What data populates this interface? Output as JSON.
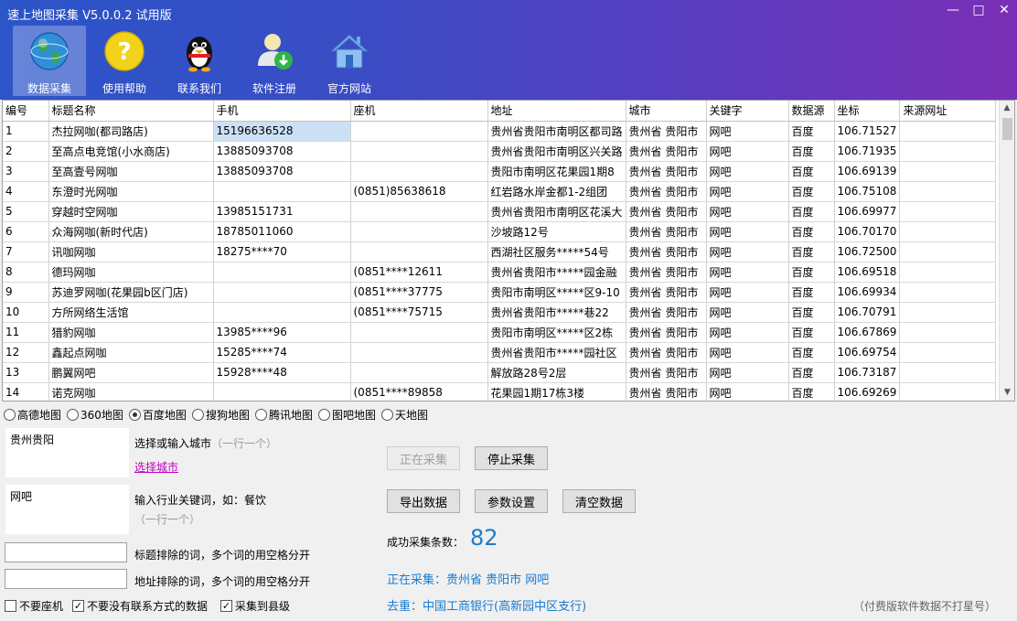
{
  "window": {
    "title": "速上地图采集 V5.0.0.2 试用版",
    "controls": [
      "—",
      "□",
      "✕"
    ]
  },
  "toolbar": [
    {
      "label": "数据采集",
      "icon": "globe-icon"
    },
    {
      "label": "使用帮助",
      "icon": "help-icon"
    },
    {
      "label": "联系我们",
      "icon": "qq-penguin-icon"
    },
    {
      "label": "软件注册",
      "icon": "user-register-icon"
    },
    {
      "label": "官方网站",
      "icon": "home-icon"
    }
  ],
  "table": {
    "columns": [
      "编号",
      "标题名称",
      "手机",
      "座机",
      "地址",
      "城市",
      "关键字",
      "数据源",
      "坐标",
      "来源网址"
    ],
    "rows": [
      [
        "1",
        "杰拉网咖(都司路店)",
        "15196636528",
        "",
        "贵州省贵阳市南明区都司路",
        "贵州省 贵阳市",
        "网吧",
        "百度",
        "106.71527",
        ""
      ],
      [
        "2",
        "至高点电竞馆(小水商店)",
        "13885093708",
        "",
        "贵州省贵阳市南明区兴关路",
        "贵州省 贵阳市",
        "网吧",
        "百度",
        "106.71935",
        ""
      ],
      [
        "3",
        "至高壹号网咖",
        "13885093708",
        "",
        "贵阳市南明区花果园1期8",
        "贵州省 贵阳市",
        "网吧",
        "百度",
        "106.69139",
        ""
      ],
      [
        "4",
        "东澄时光网咖",
        "",
        "(0851)85638618",
        "红岩路水岸金都1-2组团",
        "贵州省 贵阳市",
        "网吧",
        "百度",
        "106.75108",
        ""
      ],
      [
        "5",
        "穿越时空网咖",
        "13985151731",
        "",
        "贵州省贵阳市南明区花溪大",
        "贵州省 贵阳市",
        "网吧",
        "百度",
        "106.69977",
        ""
      ],
      [
        "6",
        "众海网咖(新时代店)",
        "18785011060",
        "",
        "沙坡路12号",
        "贵州省 贵阳市",
        "网吧",
        "百度",
        "106.70170",
        ""
      ],
      [
        "7",
        "讯咖网咖",
        "18275****70",
        "",
        "西湖社区服务*****54号",
        "贵州省 贵阳市",
        "网吧",
        "百度",
        "106.72500",
        ""
      ],
      [
        "8",
        "德玛网咖",
        "",
        "(0851****12611",
        "贵州省贵阳市*****园金融",
        "贵州省 贵阳市",
        "网吧",
        "百度",
        "106.69518",
        ""
      ],
      [
        "9",
        "苏迪罗网咖(花果园b区门店)",
        "",
        "(0851****37775",
        "贵阳市南明区*****区9-10",
        "贵州省 贵阳市",
        "网吧",
        "百度",
        "106.69934",
        ""
      ],
      [
        "10",
        "方所网络生活馆",
        "",
        "(0851****75715",
        "贵州省贵阳市*****巷22",
        "贵州省 贵阳市",
        "网吧",
        "百度",
        "106.70791",
        ""
      ],
      [
        "11",
        "猎豹网咖",
        "13985****96",
        "",
        "贵阳市南明区*****区2栋",
        "贵州省 贵阳市",
        "网吧",
        "百度",
        "106.67869",
        ""
      ],
      [
        "12",
        "鑫起点网咖",
        "15285****74",
        "",
        "贵州省贵阳市*****园社区",
        "贵州省 贵阳市",
        "网吧",
        "百度",
        "106.69754",
        ""
      ],
      [
        "13",
        "鹏翼网吧",
        "15928****48",
        "",
        "解放路28号2层",
        "贵州省 贵阳市",
        "网吧",
        "百度",
        "106.73187",
        ""
      ],
      [
        "14",
        "诺克网咖",
        "",
        "(0851****89858",
        "花果园1期17栋3楼",
        "贵州省 贵阳市",
        "网吧",
        "百度",
        "106.69269",
        ""
      ]
    ]
  },
  "maps": {
    "options": [
      "高德地图",
      "360地图",
      "百度地图",
      "搜狗地图",
      "腾讯地图",
      "图吧地图",
      "天地图"
    ],
    "selected": "百度地图"
  },
  "city": {
    "value": "贵州贵阳",
    "label": "选择或输入城市",
    "hint": "（一行一个）",
    "link": "选择城市"
  },
  "keyword": {
    "value": "网吧",
    "label": "输入行业关键词，如：餐饮",
    "hint": "（一行一个）"
  },
  "exclude": {
    "title_label": "标题排除的词，多个词的用空格分开",
    "address_label": "地址排除的词，多个词的用空格分开"
  },
  "checkboxes": [
    {
      "label": "不要座机",
      "checked": false
    },
    {
      "label": "不要没有联系方式的数据",
      "checked": true
    },
    {
      "label": "采集到县级",
      "checked": true
    }
  ],
  "buttons": {
    "collecting": "正在采集",
    "stop": "停止采集",
    "export": "导出数据",
    "settings": "参数设置",
    "clear": "清空数据"
  },
  "status": {
    "count_label": "成功采集条数：",
    "count": "82",
    "collecting_text": "正在采集：贵州省 贵阳市 网吧",
    "dedup_text": "去重：中国工商银行(高新园中区支行)",
    "note": "（付费版软件数据不打星号）"
  }
}
